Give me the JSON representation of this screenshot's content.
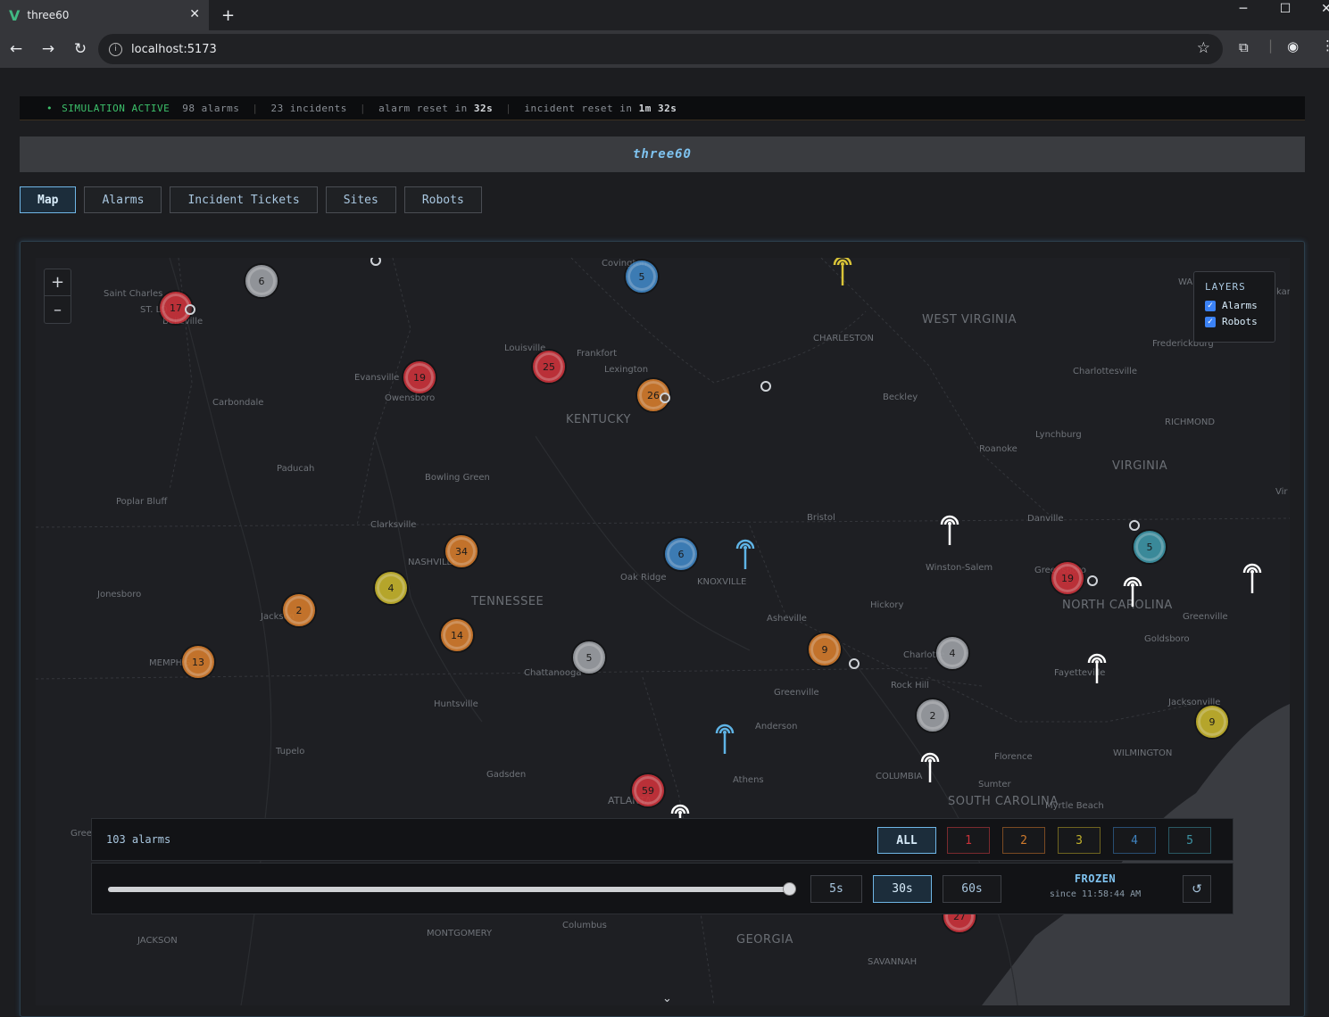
{
  "browser": {
    "tab_title": "three60",
    "tab_logo": "V",
    "url": "localhost:5173"
  },
  "status": {
    "indicator": "SIMULATION ACTIVE",
    "alarms": "98 alarms",
    "incidents": "23 incidents",
    "alarm_reset_prefix": "alarm reset in",
    "alarm_reset_value": "32s",
    "incident_reset_prefix": "incident reset in",
    "incident_reset_value": "1m 32s"
  },
  "app": {
    "title": "three60"
  },
  "nav": {
    "tabs": [
      "Map",
      "Alarms",
      "Incident Tickets",
      "Sites",
      "Robots"
    ],
    "active": "Map"
  },
  "map": {
    "zoom_in": "+",
    "zoom_out": "–",
    "layers_title": "LAYERS",
    "layers": [
      {
        "label": "Alarms",
        "checked": true
      },
      {
        "label": "Robots",
        "checked": true
      }
    ],
    "states": [
      "WEST VIRGINIA",
      "KENTUCKY",
      "VIRGINIA",
      "TENNESSEE",
      "NORTH CAROLINA",
      "SOUTH CAROLINA",
      "GEORGIA"
    ],
    "cities": [
      "Covington",
      "Saint Charles",
      "ST. LO",
      "Belleville",
      "CHARLESTON",
      "Frederickburg",
      "Louisville",
      "Frankfort",
      "Lexington",
      "Evansville",
      "Owensboro",
      "Charlottesville",
      "Carbondale",
      "Beckley",
      "RICHMOND",
      "Lynchburg",
      "Roanoke",
      "Paducah",
      "Bowling Green",
      "Poplar Bluff",
      "Bristol",
      "Danville",
      "Clarksville",
      "NASHVILLE",
      "Winston-Salem",
      "Greensboro",
      "Oak Ridge",
      "KNOXVILLE",
      "Jonesboro",
      "Hickory",
      "Greenville",
      "Jackson",
      "Asheville",
      "Goldsboro",
      "MEMPHIS",
      "Charlotte",
      "Fayetteville",
      "Chattanooga",
      "Rock Hill",
      "Greenville",
      "Jacksonville",
      "Huntsville",
      "Anderson",
      "WILMINGTON",
      "Tupelo",
      "Florence",
      "COLUMBIA",
      "Gadsden",
      "Athens",
      "Sumter",
      "ATLANTA",
      "Myrtle Beach",
      "JACKSON",
      "MONTGOMERY",
      "Columbus",
      "SAVANNAH",
      "Gree",
      "Vir",
      "WA",
      "kan"
    ],
    "clusters": [
      {
        "count": "6",
        "severity": 0
      },
      {
        "count": "17",
        "severity": 1
      },
      {
        "count": "5",
        "severity": 4
      },
      {
        "count": "25",
        "severity": 1
      },
      {
        "count": "19",
        "severity": 1
      },
      {
        "count": "26",
        "severity": 2
      },
      {
        "count": "34",
        "severity": 2
      },
      {
        "count": "4",
        "severity": 3
      },
      {
        "count": "2",
        "severity": 2
      },
      {
        "count": "14",
        "severity": 2
      },
      {
        "count": "13",
        "severity": 2
      },
      {
        "count": "5",
        "severity": 0
      },
      {
        "count": "6",
        "severity": 4
      },
      {
        "count": "9",
        "severity": 2
      },
      {
        "count": "4",
        "severity": 0
      },
      {
        "count": "2",
        "severity": 0
      },
      {
        "count": "19",
        "severity": 1
      },
      {
        "count": "5",
        "severity": 5
      },
      {
        "count": "9",
        "severity": 3
      },
      {
        "count": "59",
        "severity": 1
      },
      {
        "count": "27",
        "severity": 1
      }
    ],
    "expand_chevron": "⌄"
  },
  "alarm_panel": {
    "count": "103 alarms",
    "filters": [
      "ALL",
      "1",
      "2",
      "3",
      "4",
      "5"
    ],
    "active_filter": "ALL"
  },
  "time_panel": {
    "slider_value_pct": 100,
    "windows": [
      "5s",
      "30s",
      "60s"
    ],
    "active_window": "30s",
    "state": "FROZEN",
    "since": "since 11:58:44 AM",
    "reset_icon": "↺"
  },
  "colors": {
    "sev0": "#9a9da2",
    "sev1": "#c8323a",
    "sev2": "#d07a2c",
    "sev3": "#c2b12c",
    "sev4": "#3f83c0",
    "sev5": "#3d93a4",
    "accent": "#7fc3f0"
  }
}
